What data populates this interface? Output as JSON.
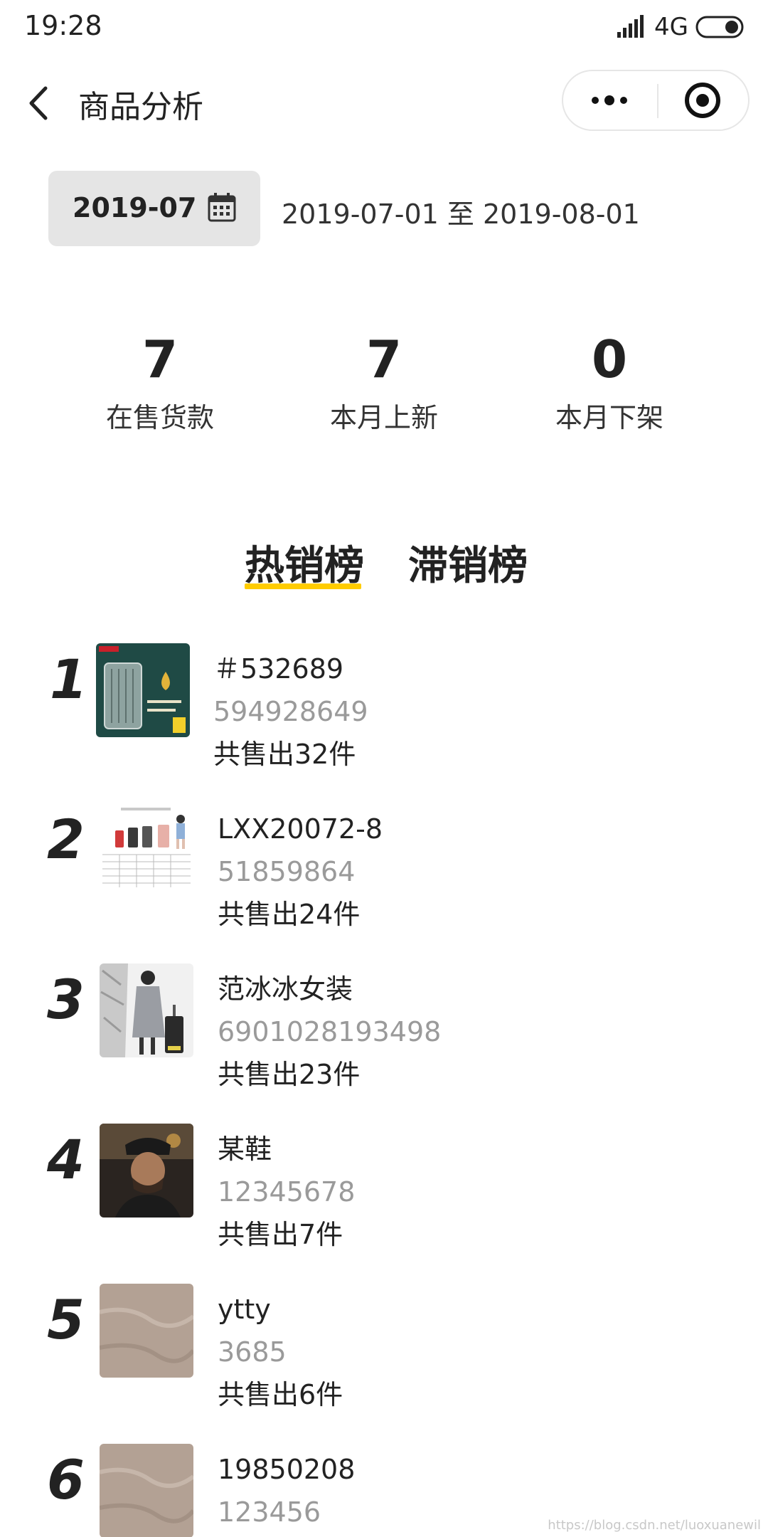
{
  "status_bar": {
    "time": "19:28",
    "network": "4G",
    "signal_icon": "signal-icon",
    "battery_icon": "battery-icon"
  },
  "nav": {
    "title": "商品分析",
    "back_icon": "chevron-left-icon",
    "more_icon": "more-dots-icon",
    "close_icon": "target-icon"
  },
  "date_filter": {
    "month": "2019-07",
    "range": "2019-07-01 至 2019-08-01",
    "icon": "calendar-icon"
  },
  "stats": [
    {
      "value": "7",
      "label": "在售货款"
    },
    {
      "value": "7",
      "label": "本月上新"
    },
    {
      "value": "0",
      "label": "本月下架"
    }
  ],
  "tabs": [
    {
      "label": "热销榜",
      "active": true
    },
    {
      "label": "滞销榜",
      "active": false
    }
  ],
  "colors": {
    "accent": "#ffcc00",
    "muted_text": "#9a9a9a",
    "date_button_bg": "#e5e5e5"
  },
  "items": [
    {
      "rank": "1",
      "name": "＃532689",
      "code": "594928649",
      "sold": "共售出32件",
      "thumb": "suitcase-ad-image"
    },
    {
      "rank": "2",
      "name": "LXX20072-8",
      "code": "51859864",
      "sold": "共售出24件",
      "thumb": "luggage-size-chart-image"
    },
    {
      "rank": "3",
      "name": "范冰冰女装",
      "code": "6901028193498",
      "sold": "共售出23件",
      "thumb": "woman-coat-suitcase-image"
    },
    {
      "rank": "4",
      "name": "某鞋",
      "code": "12345678",
      "sold": "共售出7件",
      "thumb": "man-portrait-image"
    },
    {
      "rank": "5",
      "name": "ytty",
      "code": "3685",
      "sold": "共售出6件",
      "thumb": "stone-texture-image"
    },
    {
      "rank": "6",
      "name": "19850208",
      "code": "123456",
      "sold": "",
      "thumb": "stone-texture-image"
    }
  ],
  "watermark": "https://blog.csdn.net/luoxuanewil"
}
